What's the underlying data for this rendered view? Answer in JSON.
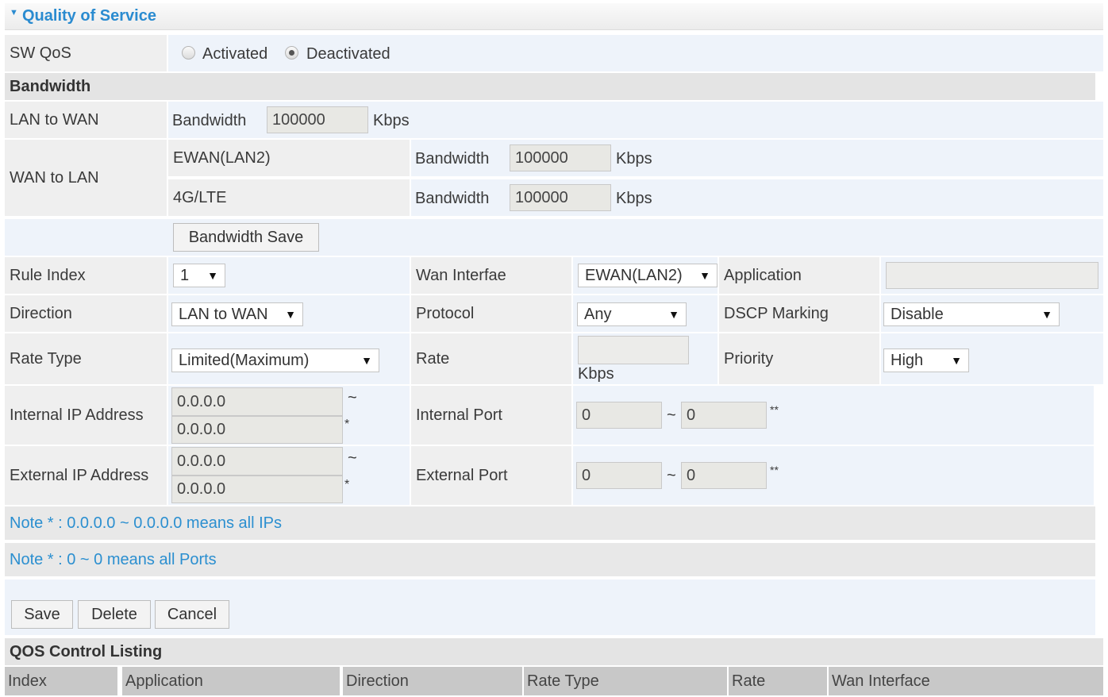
{
  "title": "Quality of Service",
  "sw_qos": {
    "label": "SW QoS",
    "options": [
      "Activated",
      "Deactivated"
    ],
    "selected": "Deactivated"
  },
  "bandwidth": {
    "section_label": "Bandwidth",
    "lan_to_wan_label": "LAN to WAN",
    "wan_to_lan_label": "WAN to LAN",
    "field_label": "Bandwidth",
    "unit": "Kbps",
    "lan_to_wan_value": "100000",
    "ewan_label": "EWAN(LAN2)",
    "ewan_value": "100000",
    "lte_label": "4G/LTE",
    "lte_value": "100000",
    "save_button": "Bandwidth Save"
  },
  "rule": {
    "rule_index_label": "Rule Index",
    "rule_index_value": "1",
    "wan_interface_label": "Wan Interfae",
    "wan_interface_value": "EWAN(LAN2)",
    "application_label": "Application",
    "application_value": "",
    "direction_label": "Direction",
    "direction_value": "LAN to WAN",
    "protocol_label": "Protocol",
    "protocol_value": "Any",
    "dscp_label": "DSCP Marking",
    "dscp_value": "Disable",
    "rate_type_label": "Rate Type",
    "rate_type_value": "Limited(Maximum)",
    "rate_label": "Rate",
    "rate_value": "",
    "rate_unit": "Kbps",
    "priority_label": "Priority",
    "priority_value": "High",
    "internal_ip_label": "Internal IP Address",
    "internal_ip_start": "0.0.0.0",
    "internal_ip_end": "0.0.0.0",
    "external_ip_label": "External IP Address",
    "external_ip_start": "0.0.0.0",
    "external_ip_end": "0.0.0.0",
    "internal_port_label": "Internal Port",
    "internal_port_start": "0",
    "internal_port_end": "0",
    "external_port_label": "External Port",
    "external_port_start": "0",
    "external_port_end": "0",
    "range_sep": "~",
    "ip_mark": "*",
    "port_mark": "**"
  },
  "notes": {
    "ip_note": "Note * : 0.0.0.0 ~ 0.0.0.0 means all IPs",
    "port_note": "Note * : 0 ~ 0 means all Ports"
  },
  "actions": {
    "save": "Save",
    "delete": "Delete",
    "cancel": "Cancel"
  },
  "listing": {
    "title": "QOS Control Listing",
    "columns": [
      "Index",
      "Application",
      "Direction",
      "Rate Type",
      "Rate",
      "Wan Interface"
    ]
  },
  "colors": {
    "title": "#2a8bd0",
    "note": "#2b8fd0",
    "label_bg": "#efefef",
    "value_bg": "#eef3fa",
    "section_bg": "#e4e4e4",
    "header_bg": "#c8c8c8"
  }
}
